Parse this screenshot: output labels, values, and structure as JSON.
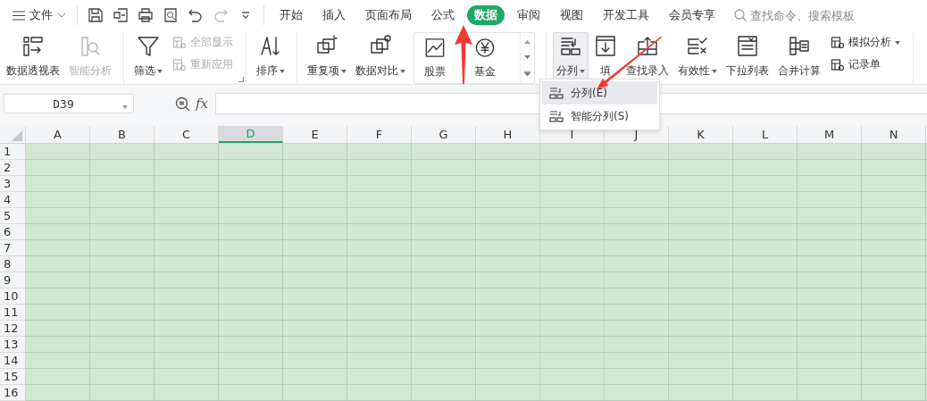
{
  "menu": {
    "label": "文件"
  },
  "tabs": [
    {
      "label": "开始",
      "selected": false
    },
    {
      "label": "插入",
      "selected": false
    },
    {
      "label": "页面布局",
      "selected": false
    },
    {
      "label": "公式",
      "selected": false
    },
    {
      "label": "数据",
      "selected": true
    },
    {
      "label": "审阅",
      "selected": false
    },
    {
      "label": "视图",
      "selected": false
    },
    {
      "label": "开发工具",
      "selected": false
    },
    {
      "label": "会员专享",
      "selected": false
    }
  ],
  "search": {
    "placeholder": "查找命令、搜索模板"
  },
  "ribbon": {
    "groups": [
      {
        "items": [
          {
            "kind": "big",
            "label": "数据透视表",
            "disabled": false,
            "dropdown": false,
            "pressed": false
          },
          {
            "kind": "big",
            "label": "智能分析",
            "disabled": true,
            "dropdown": false,
            "pressed": false
          }
        ]
      },
      {
        "launcher": true,
        "items": [
          {
            "kind": "big",
            "label": "筛选",
            "disabled": false,
            "dropdown": true,
            "pressed": false
          },
          {
            "kind": "pair",
            "items": [
              {
                "label": "全部显示",
                "disabled": true,
                "dropdown": false
              },
              {
                "label": "重新应用",
                "disabled": true,
                "dropdown": false
              }
            ]
          }
        ]
      },
      {
        "items": [
          {
            "kind": "big",
            "label": "排序",
            "disabled": false,
            "dropdown": true,
            "pressed": false
          }
        ]
      },
      {
        "items": [
          {
            "kind": "big",
            "label": "重复项",
            "disabled": false,
            "dropdown": true,
            "pressed": false
          },
          {
            "kind": "big",
            "label": "数据对比",
            "disabled": false,
            "dropdown": true,
            "pressed": false
          },
          {
            "kind": "gallery",
            "items": [
              {
                "label": "股票"
              },
              {
                "label": "基金"
              }
            ]
          }
        ]
      },
      {
        "items": [
          {
            "kind": "big",
            "label": "分列",
            "disabled": false,
            "dropdown": true,
            "pressed": true
          },
          {
            "kind": "big",
            "label": "填",
            "disabled": false,
            "dropdown": false,
            "pressed": false
          },
          {
            "kind": "big",
            "label": "查找录入",
            "disabled": false,
            "dropdown": false,
            "pressed": false
          },
          {
            "kind": "big",
            "label": "有效性",
            "disabled": false,
            "dropdown": true,
            "pressed": false
          },
          {
            "kind": "big",
            "label": "下拉列表",
            "disabled": false,
            "dropdown": false,
            "pressed": false
          },
          {
            "kind": "big",
            "label": "合并计算",
            "disabled": false,
            "dropdown": false,
            "pressed": false
          },
          {
            "kind": "pair",
            "items": [
              {
                "label": "模拟分析",
                "disabled": false,
                "dropdown": true
              },
              {
                "label": "记录单",
                "disabled": false,
                "dropdown": false
              }
            ]
          }
        ]
      }
    ]
  },
  "name_box": {
    "value": "D39"
  },
  "formula_bar": {
    "label": "fx"
  },
  "columns": [
    {
      "label": "A",
      "selected": false
    },
    {
      "label": "B",
      "selected": false
    },
    {
      "label": "C",
      "selected": false
    },
    {
      "label": "D",
      "selected": true
    },
    {
      "label": "E",
      "selected": false
    },
    {
      "label": "F",
      "selected": false
    },
    {
      "label": "G",
      "selected": false
    },
    {
      "label": "H",
      "selected": false
    },
    {
      "label": "I",
      "selected": false
    },
    {
      "label": "J",
      "selected": false
    },
    {
      "label": "K",
      "selected": false
    },
    {
      "label": "L",
      "selected": false
    },
    {
      "label": "M",
      "selected": false
    },
    {
      "label": "N",
      "selected": false
    }
  ],
  "rows": [
    "1",
    "2",
    "3",
    "4",
    "5",
    "6",
    "7",
    "8",
    "9",
    "10",
    "11",
    "12",
    "13",
    "14",
    "15",
    "16"
  ],
  "dropdown_menu": {
    "items": [
      {
        "label": "分列(E)",
        "selected": true
      },
      {
        "label": "智能分列(S)",
        "selected": false
      }
    ]
  }
}
